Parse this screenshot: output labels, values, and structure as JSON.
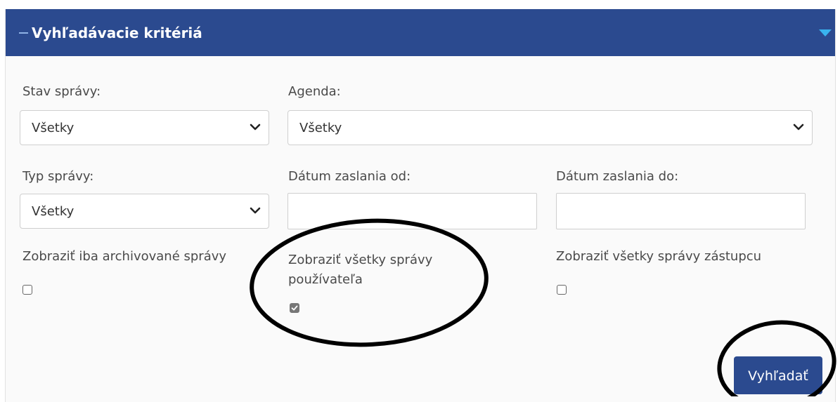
{
  "panel": {
    "title": "Vyhľadávacie kritériá"
  },
  "fields": {
    "stav_spravy": {
      "label": "Stav správy:",
      "value": "Všetky"
    },
    "agenda": {
      "label": "Agenda:",
      "value": "Všetky"
    },
    "typ_spravy": {
      "label": "Typ správy:",
      "value": "Všetky"
    },
    "datum_od": {
      "label": "Dátum zaslania od:",
      "value": ""
    },
    "datum_do": {
      "label": "Dátum zaslania do:",
      "value": ""
    }
  },
  "checkboxes": {
    "archivovane": {
      "label": "Zobraziť iba archivované správy",
      "checked": false
    },
    "vsetky_pouzivatela": {
      "label_line1": "Zobraziť všetky správy",
      "label_line2": "používateľa",
      "checked": true
    },
    "vsetky_zastupcu": {
      "label": "Zobraziť všetky správy zástupcu",
      "checked": false
    }
  },
  "actions": {
    "search_label": "Vyhľadať"
  },
  "colors": {
    "header_bg": "#2b4a8f",
    "button_bg": "#2b4a8f",
    "header_chevron": "#39b3ee"
  },
  "icons": {
    "header_collapse": "minus-icon",
    "header_toggle": "chevron-down-icon",
    "select_arrow": "chevron-down-icon",
    "checkbox_checked": "checkmark-icon"
  }
}
